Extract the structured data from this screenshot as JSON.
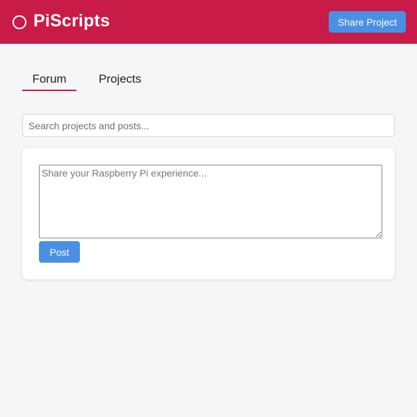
{
  "header": {
    "logo_icon": "circle-outline-icon",
    "title": "PiScripts",
    "share_label": "Share Project",
    "background_color": "#c81b47",
    "button_color": "#4a90e2"
  },
  "tabs": [
    {
      "label": "Forum",
      "active": true
    },
    {
      "label": "Projects",
      "active": false
    }
  ],
  "search": {
    "value": "",
    "placeholder": "Search projects and posts..."
  },
  "composer": {
    "value": "",
    "placeholder": "Share your Raspberry Pi experience...",
    "post_label": "Post"
  }
}
